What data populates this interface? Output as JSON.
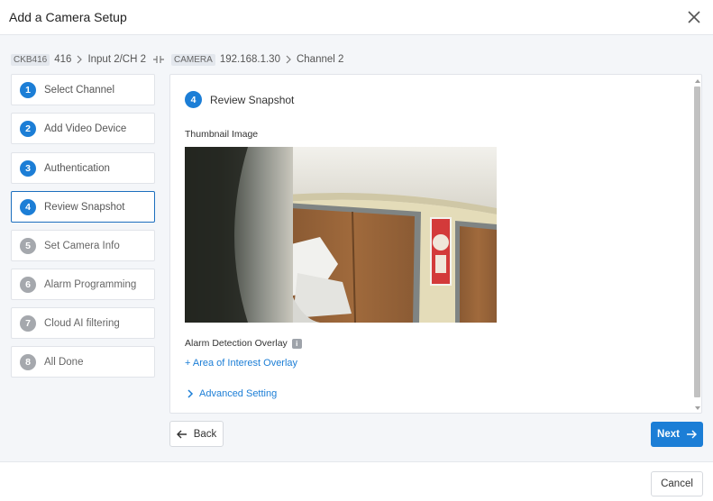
{
  "dialog": {
    "title": "Add a Camera Setup"
  },
  "breadcrumb": {
    "device_tag": "CKB416",
    "device_id": "416",
    "input": "Input 2/CH 2",
    "camera_tag": "CAMERA",
    "camera_ip": "192.168.1.30",
    "channel": "Channel 2"
  },
  "steps": [
    {
      "num": "1",
      "label": "Select Channel",
      "state": "done"
    },
    {
      "num": "2",
      "label": "Add Video Device",
      "state": "done"
    },
    {
      "num": "3",
      "label": "Authentication",
      "state": "done"
    },
    {
      "num": "4",
      "label": "Review Snapshot",
      "state": "active"
    },
    {
      "num": "5",
      "label": "Set Camera Info",
      "state": "todo"
    },
    {
      "num": "6",
      "label": "Alarm Programming",
      "state": "todo"
    },
    {
      "num": "7",
      "label": "Cloud AI filtering",
      "state": "todo"
    },
    {
      "num": "8",
      "label": "All Done",
      "state": "todo"
    }
  ],
  "panel": {
    "step_num": "4",
    "title": "Review Snapshot",
    "thumbnail_label": "Thumbnail Image",
    "overlay_label": "Alarm Detection Overlay",
    "overlay_link": "+ Area of Interest Overlay",
    "advanced_label": "Advanced Setting"
  },
  "buttons": {
    "back": "Back",
    "next": "Next",
    "cancel": "Cancel"
  },
  "colors": {
    "accent": "#1c7ed6",
    "pending": "#a5a8ad"
  }
}
